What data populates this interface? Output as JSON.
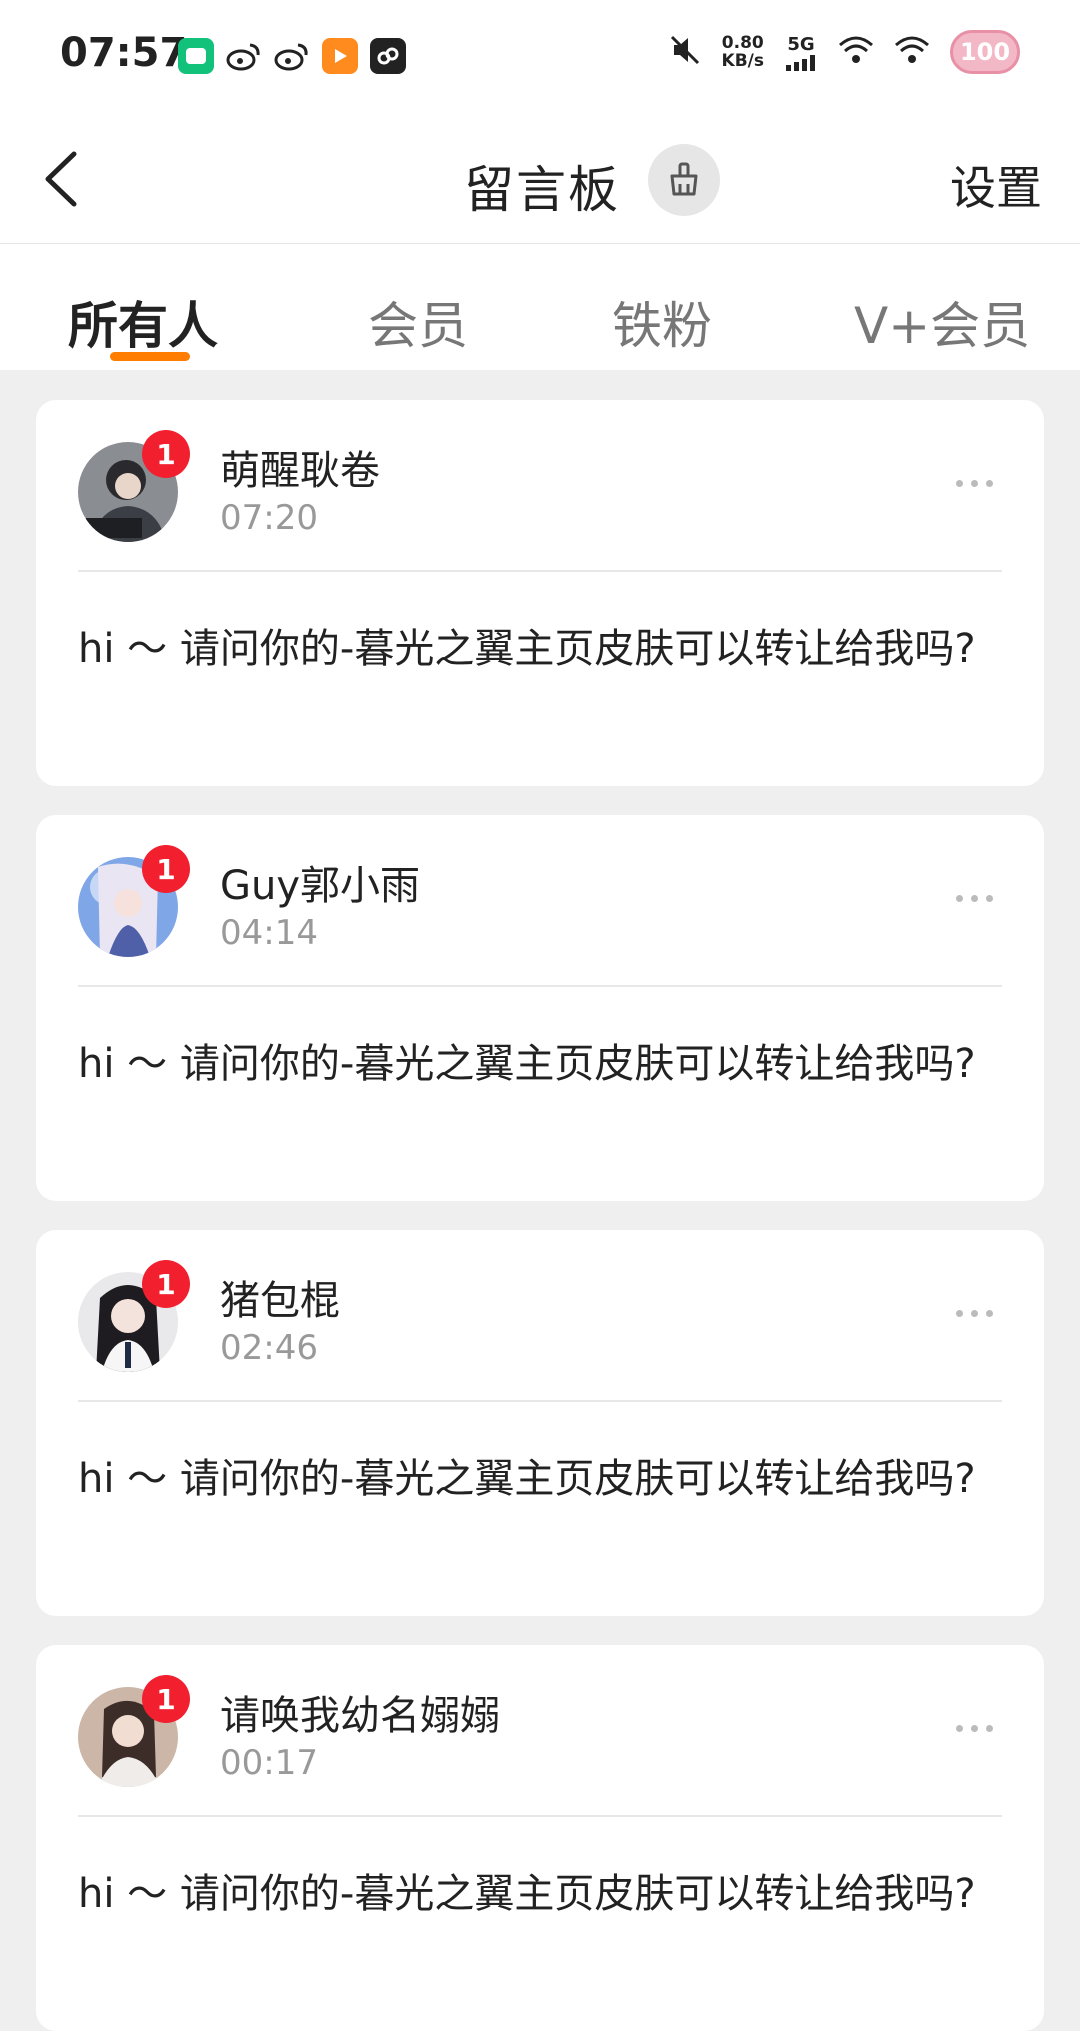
{
  "status_bar": {
    "time": "07:57",
    "net_speed_value": "0.80",
    "net_speed_unit": "KB/s",
    "network": "5G",
    "battery": "100"
  },
  "nav": {
    "title": "留言板",
    "settings_label": "设置"
  },
  "tabs": [
    {
      "label": "所有人",
      "active": true
    },
    {
      "label": "会员",
      "active": false
    },
    {
      "label": "铁粉",
      "active": false
    },
    {
      "label": "V+会员",
      "active": false
    }
  ],
  "messages": [
    {
      "name": "萌醒耿卷",
      "time": "07:20",
      "badge": "1",
      "text": "hi ～ 请问你的-暮光之翼主页皮肤可以转让给我吗?"
    },
    {
      "name": "Guy郭小雨",
      "time": "04:14",
      "badge": "1",
      "text": "hi ～ 请问你的-暮光之翼主页皮肤可以转让给我吗?"
    },
    {
      "name": "猪包棍",
      "time": "02:46",
      "badge": "1",
      "text": "hi ～ 请问你的-暮光之翼主页皮肤可以转让给我吗?"
    },
    {
      "name": "请唤我幼名嫋嫋",
      "time": "00:17",
      "badge": "1",
      "text": "hi ～ 请问你的-暮光之翼主页皮肤可以转让给我吗?"
    }
  ],
  "colors": {
    "accent": "#ff7d00",
    "badge": "#f21f2f",
    "background": "#efefef"
  }
}
